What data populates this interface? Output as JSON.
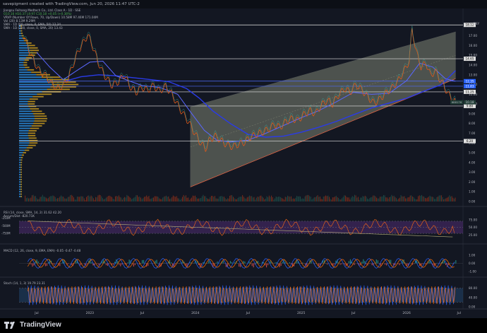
{
  "header": {
    "credit": "savepigment created with TradingView.com, Jun 20, 2026 11:47 UTC-2"
  },
  "main_legend": {
    "title": "Jiangsu Feihang Medtech Co., Ltd. Class A · 1D · SSE",
    "ohlc": "O10.16 H10.37 L9.97 C10.18 +0.05 (+0.38%)",
    "vol_label": "Vol 13M",
    "vrvp": "VRVP (Number Of Rows, 70, Up/Down) 10.58M  97.46M  171.04M",
    "vol20": "Vol (20) 8.13M 9.29M",
    "sma1": "SMA - 1D (50, close, 0, SMA, 50) 12.34",
    "sma2": "SMA - 1D (200, close, 0, SMA, 20) 13.43"
  },
  "currency": "CNY",
  "price_axis": {
    "ticks": [
      "17.00",
      "16.00",
      "15.00",
      "14.00",
      "13.00",
      "12.00",
      "11.00",
      "10.00",
      "9.00",
      "8.00",
      "7.00",
      "6.00",
      "5.00",
      "4.00",
      "3.00",
      "2.00",
      "1.00",
      "0.00"
    ],
    "badges": [
      {
        "label": "18.12",
        "bg": "#e0e0e0",
        "fg": "#000"
      },
      {
        "label": "14.65",
        "bg": "#e0e0e0",
        "fg": "#000"
      },
      {
        "label": "12.35",
        "bg": "#2962ff",
        "fg": "#fff"
      },
      {
        "label": "11.83",
        "bg": "#2962ff",
        "fg": "#fff"
      },
      {
        "label": "11.25",
        "bg": "#e0e0e0",
        "fg": "#000"
      },
      {
        "label": "9.80",
        "bg": "#e0e0e0",
        "fg": "#000"
      },
      {
        "label": "6.20",
        "bg": "#e0e0e0",
        "fg": "#000"
      }
    ],
    "last_price_label": "688176",
    "last_price": "10.18"
  },
  "rsi_panel": {
    "legend": "RSI (14, close, SMA, 14, 2) 31.62 42.20",
    "legend2": "Accum/Dist -820.71K",
    "left_ticks": [
      "-250M",
      "-500M",
      "-750M"
    ],
    "right_ticks": [
      "75.00",
      "50.00",
      "25.00"
    ]
  },
  "macd_panel": {
    "legend": "MACD (12, 26, close, 9, EMA, EMA) -0.05 -0.47 -0.48",
    "right_ticks": [
      "1.00",
      "0.00",
      "-1.00"
    ]
  },
  "stoch_panel": {
    "legend": "Stoch (14, 1, 3) 19.79 23.31",
    "right_ticks": [
      "80.00",
      "40.00",
      "0.00"
    ]
  },
  "time_axis": [
    "Jul",
    "2023",
    "Jul",
    "2024",
    "Jul",
    "2025",
    "Jul",
    "2026",
    "Jul"
  ],
  "branding": "TradingView",
  "chart_data": {
    "type": "line",
    "title": "Jiangsu Feihang Medtech Co., Ltd. Class A · 1D · SSE",
    "price_range": [
      0,
      18.5
    ],
    "time_range": [
      "2022-05",
      "2026-07"
    ],
    "horizontal_levels": [
      18.12,
      14.65,
      12.35,
      11.83,
      11.25,
      9.8,
      6.2
    ],
    "price_series": [
      [
        "2022-05-15",
        17.2
      ],
      [
        "2022-06-01",
        15.8
      ],
      [
        "2022-06-20",
        14.5
      ],
      [
        "2022-07-10",
        13.4
      ],
      [
        "2022-08-01",
        12.9
      ],
      [
        "2022-08-20",
        12.2
      ],
      [
        "2022-09-10",
        11.6
      ],
      [
        "2022-10-01",
        11.9
      ],
      [
        "2022-10-20",
        12.8
      ],
      [
        "2022-11-10",
        14.5
      ],
      [
        "2022-11-25",
        15.6
      ],
      [
        "2022-12-10",
        16.3
      ],
      [
        "2022-12-25",
        17.1
      ],
      [
        "2023-01-10",
        16.0
      ],
      [
        "2023-01-25",
        14.7
      ],
      [
        "2023-02-10",
        13.5
      ],
      [
        "2023-03-01",
        12.6
      ],
      [
        "2023-03-20",
        11.9
      ],
      [
        "2023-04-10",
        12.3
      ],
      [
        "2023-05-01",
        13.0
      ],
      [
        "2023-05-20",
        11.8
      ],
      [
        "2023-06-10",
        11.2
      ],
      [
        "2023-07-01",
        11.7
      ],
      [
        "2023-07-20",
        11.4
      ],
      [
        "2023-08-10",
        11.9
      ],
      [
        "2023-08-30",
        11.3
      ],
      [
        "2023-09-20",
        11.8
      ],
      [
        "2023-10-10",
        11.1
      ],
      [
        "2023-11-01",
        9.9
      ],
      [
        "2023-11-20",
        9.0
      ],
      [
        "2023-12-10",
        8.1
      ],
      [
        "2024-01-01",
        6.9
      ],
      [
        "2024-01-20",
        6.0
      ],
      [
        "2024-02-05",
        5.4
      ],
      [
        "2024-02-20",
        6.3
      ],
      [
        "2024-03-10",
        6.7
      ],
      [
        "2024-04-01",
        6.2
      ],
      [
        "2024-04-20",
        5.8
      ],
      [
        "2024-05-10",
        5.6
      ],
      [
        "2024-06-01",
        5.9
      ],
      [
        "2024-06-20",
        6.1
      ],
      [
        "2024-07-10",
        6.6
      ],
      [
        "2024-08-01",
        6.9
      ],
      [
        "2024-08-20",
        7.1
      ],
      [
        "2024-09-10",
        7.4
      ],
      [
        "2024-10-01",
        7.9
      ],
      [
        "2024-10-20",
        7.6
      ],
      [
        "2024-11-10",
        8.2
      ],
      [
        "2024-12-01",
        8.5
      ],
      [
        "2024-12-20",
        8.3
      ],
      [
        "2025-01-10",
        8.9
      ],
      [
        "2025-02-01",
        9.3
      ],
      [
        "2025-02-20",
        9.0
      ],
      [
        "2025-03-10",
        9.8
      ],
      [
        "2025-04-01",
        10.4
      ],
      [
        "2025-04-20",
        10.0
      ],
      [
        "2025-05-10",
        10.9
      ],
      [
        "2025-06-01",
        11.6
      ],
      [
        "2025-06-20",
        11.2
      ],
      [
        "2025-07-10",
        12.0
      ],
      [
        "2025-08-01",
        11.4
      ],
      [
        "2025-08-20",
        10.7
      ],
      [
        "2025-09-10",
        10.1
      ],
      [
        "2025-10-01",
        10.5
      ],
      [
        "2025-10-20",
        11.1
      ],
      [
        "2025-11-10",
        11.6
      ],
      [
        "2025-12-01",
        12.3
      ],
      [
        "2025-12-20",
        13.2
      ],
      [
        "2026-01-10",
        14.4
      ],
      [
        "2026-01-20",
        17.6
      ],
      [
        "2026-02-05",
        15.2
      ],
      [
        "2026-02-20",
        13.8
      ],
      [
        "2026-03-10",
        14.2
      ],
      [
        "2026-03-25",
        12.9
      ],
      [
        "2026-04-10",
        13.4
      ],
      [
        "2026-04-25",
        12.6
      ],
      [
        "2026-05-10",
        11.9
      ],
      [
        "2026-05-25",
        11.0
      ],
      [
        "2026-06-10",
        10.5
      ],
      [
        "2026-06-19",
        10.18
      ]
    ],
    "sma_50": [
      [
        "2022-07-01",
        15.3
      ],
      [
        "2022-08-15",
        13.8
      ],
      [
        "2022-10-01",
        12.5
      ],
      [
        "2022-11-15",
        13.4
      ],
      [
        "2023-01-01",
        14.3
      ],
      [
        "2023-02-15",
        14.4
      ],
      [
        "2023-04-01",
        12.9
      ],
      [
        "2023-05-15",
        12.4
      ],
      [
        "2023-07-01",
        11.9
      ],
      [
        "2023-09-01",
        11.7
      ],
      [
        "2023-11-01",
        11.0
      ],
      [
        "2023-12-15",
        9.2
      ],
      [
        "2024-02-01",
        7.3
      ],
      [
        "2024-03-15",
        6.3
      ],
      [
        "2024-05-01",
        6.1
      ],
      [
        "2024-07-01",
        6.3
      ],
      [
        "2024-09-01",
        7.0
      ],
      [
        "2024-11-01",
        7.8
      ],
      [
        "2025-01-01",
        8.6
      ],
      [
        "2025-03-01",
        9.3
      ],
      [
        "2025-05-01",
        10.2
      ],
      [
        "2025-07-01",
        11.2
      ],
      [
        "2025-09-01",
        11.0
      ],
      [
        "2025-11-01",
        11.1
      ],
      [
        "2026-01-01",
        12.4
      ],
      [
        "2026-02-15",
        14.2
      ],
      [
        "2026-04-01",
        13.8
      ],
      [
        "2026-05-15",
        12.6
      ],
      [
        "2026-06-19",
        12.34
      ]
    ],
    "sma_200": [
      [
        "2022-10-01",
        12.3
      ],
      [
        "2022-12-01",
        12.8
      ],
      [
        "2023-02-01",
        13.0
      ],
      [
        "2023-04-01",
        12.9
      ],
      [
        "2023-06-01",
        12.7
      ],
      [
        "2023-08-01",
        12.5
      ],
      [
        "2023-10-01",
        12.3
      ],
      [
        "2023-12-01",
        11.6
      ],
      [
        "2024-01-15",
        10.6
      ],
      [
        "2024-03-01",
        9.3
      ],
      [
        "2024-05-01",
        8.0
      ],
      [
        "2024-07-01",
        6.9
      ],
      [
        "2024-09-01",
        6.6
      ],
      [
        "2024-11-01",
        6.7
      ],
      [
        "2025-01-01",
        7.1
      ],
      [
        "2025-03-01",
        7.6
      ],
      [
        "2025-05-01",
        8.2
      ],
      [
        "2025-07-01",
        8.9
      ],
      [
        "2025-09-01",
        9.6
      ],
      [
        "2025-11-01",
        10.1
      ],
      [
        "2026-01-01",
        10.6
      ],
      [
        "2026-03-01",
        11.3
      ],
      [
        "2026-05-01",
        12.0
      ],
      [
        "2026-06-19",
        13.43
      ]
    ],
    "channel": {
      "upper": [
        [
          "2023-12-15",
          9.7
        ],
        [
          "2026-06-19",
          17.4
        ]
      ],
      "lower": [
        [
          "2023-12-15",
          1.5
        ],
        [
          "2026-06-19",
          12.6
        ]
      ]
    },
    "rsi_range": [
      0,
      100
    ],
    "rsi_levels": [
      70,
      50,
      30
    ],
    "stoch_levels": [
      80,
      20
    ],
    "macd_range": [
      -1.5,
      1.5
    ]
  },
  "colors": {
    "background": "#131722",
    "candle_line": "#e05a1a",
    "sma_fast": "#5a67ff",
    "sma_slow": "#2a3be8",
    "channel_fill": "#b8c0a0",
    "channel_line": "#e06040",
    "vrvp_up": "#2a8ee0",
    "vrvp_down": "#c89a1e",
    "rsi_fill": "#4a2a6a",
    "stoch_fill": "#1e3a5a"
  }
}
